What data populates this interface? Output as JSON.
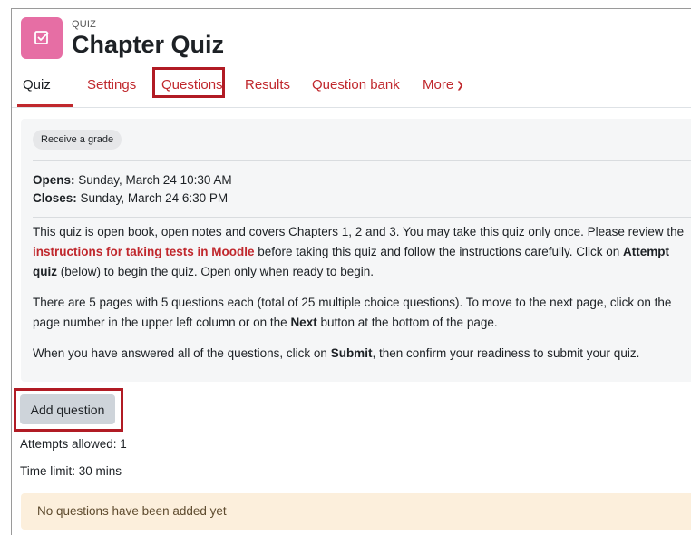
{
  "header": {
    "type_label": "QUIZ",
    "title": "Chapter Quiz",
    "icon": "quiz-checkbox-icon",
    "icon_color": "#e66ea4"
  },
  "nav": {
    "tabs": [
      {
        "label": "Quiz",
        "active": true
      },
      {
        "label": "Settings"
      },
      {
        "label": "Questions",
        "highlighted": true
      },
      {
        "label": "Results"
      },
      {
        "label": "Question bank"
      },
      {
        "label": "More"
      }
    ],
    "more_icon": "chevron-down-icon",
    "accent": "#c0282d"
  },
  "activity": {
    "badge": "Receive a grade",
    "opens_label": "Opens:",
    "opens_value": " Sunday, March 24 10:30 AM",
    "closes_label": "Closes:",
    "closes_value": " Sunday, March 24 6:30 PM",
    "p1_before": "This quiz is open book, open notes and covers Chapters 1, 2 and 3. You may take this quiz only once. Please review the ",
    "p1_link": "instructions for taking tests in Moodle",
    "p1_middle": " before taking this quiz and follow the instructions carefully. Click on ",
    "p1_bold": "Attempt quiz",
    "p1_after": " (below) to begin the quiz. Open only when ready to begin.",
    "p2_before": "There are 5 pages with 5 questions each (total of 25 multiple choice questions). To move to the next page, click on the page number in the upper left column or on the ",
    "p2_bold": "Next",
    "p2_after": " button at the bottom of the page.",
    "p3_before": "When you have answered all of the questions, click on ",
    "p3_bold": "Submit",
    "p3_after": ", then confirm your readiness to submit your quiz."
  },
  "actions": {
    "add_question": "Add question"
  },
  "info": {
    "attempts": "Attempts allowed: 1",
    "time_limit": "Time limit: 30 mins"
  },
  "notice": {
    "text": "No questions have been added yet",
    "color": "#fcefdc"
  },
  "highlight_color": "#b11b24"
}
